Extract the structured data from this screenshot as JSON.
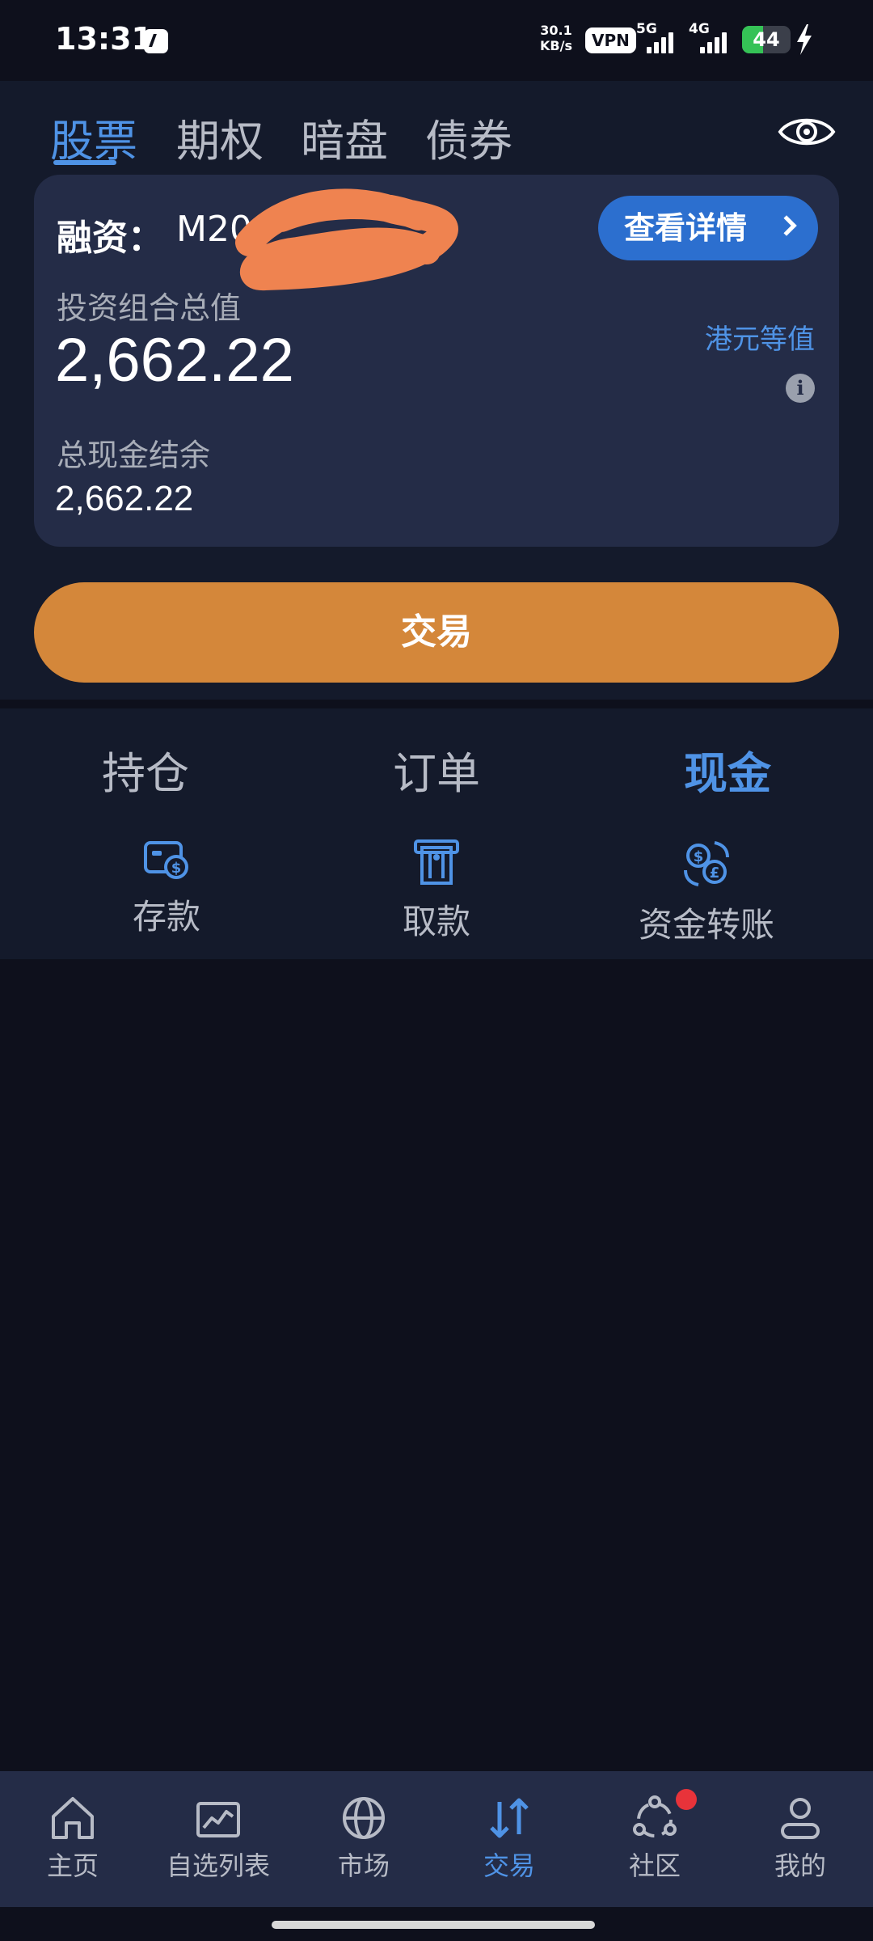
{
  "status_bar": {
    "time": "13:31",
    "net_speed_value": "30.1",
    "net_speed_unit": "KB/s",
    "vpn": "VPN",
    "net_5g": "5G",
    "net_4g": "4G",
    "battery": "44",
    "battery_level": 0.44
  },
  "asset_tabs": [
    {
      "label": "股票",
      "active": true
    },
    {
      "label": "期权",
      "active": false
    },
    {
      "label": "暗盘",
      "active": false
    },
    {
      "label": "债券",
      "active": false
    }
  ],
  "account": {
    "label": "融资：",
    "id_visible": "M20",
    "details_button": "查看详情",
    "portfolio_label": "投资组合总值",
    "portfolio_value": "2,662.22",
    "currency_label": "港元等值",
    "cash_label": "总现金结余",
    "cash_value": "2,662.22"
  },
  "trade_button": "交易",
  "section_tabs": [
    {
      "label": "持仓",
      "active": false
    },
    {
      "label": "订单",
      "active": false
    },
    {
      "label": "现金",
      "active": true
    }
  ],
  "cash_actions": [
    {
      "label": "存款",
      "icon": "deposit-icon"
    },
    {
      "label": "取款",
      "icon": "withdraw-icon"
    },
    {
      "label": "资金转账",
      "icon": "fund-transfer-icon"
    }
  ],
  "bottom_nav": [
    {
      "label": "主页",
      "icon": "home-icon",
      "active": false
    },
    {
      "label": "自选列表",
      "icon": "watchlist-icon",
      "active": false
    },
    {
      "label": "市场",
      "icon": "globe-icon",
      "active": false
    },
    {
      "label": "交易",
      "icon": "trade-arrows-icon",
      "active": true
    },
    {
      "label": "社区",
      "icon": "community-icon",
      "active": false,
      "badge": true
    },
    {
      "label": "我的",
      "icon": "profile-icon",
      "active": false
    }
  ],
  "colors": {
    "background": "#0e101c",
    "panel": "#141a2b",
    "card": "#242c47",
    "accent_blue": "#4f93e6",
    "button_blue": "#2c6fcf",
    "trade_orange": "#d4873a",
    "text_muted": "#b7bbc6",
    "badge_red": "#e8333a"
  }
}
